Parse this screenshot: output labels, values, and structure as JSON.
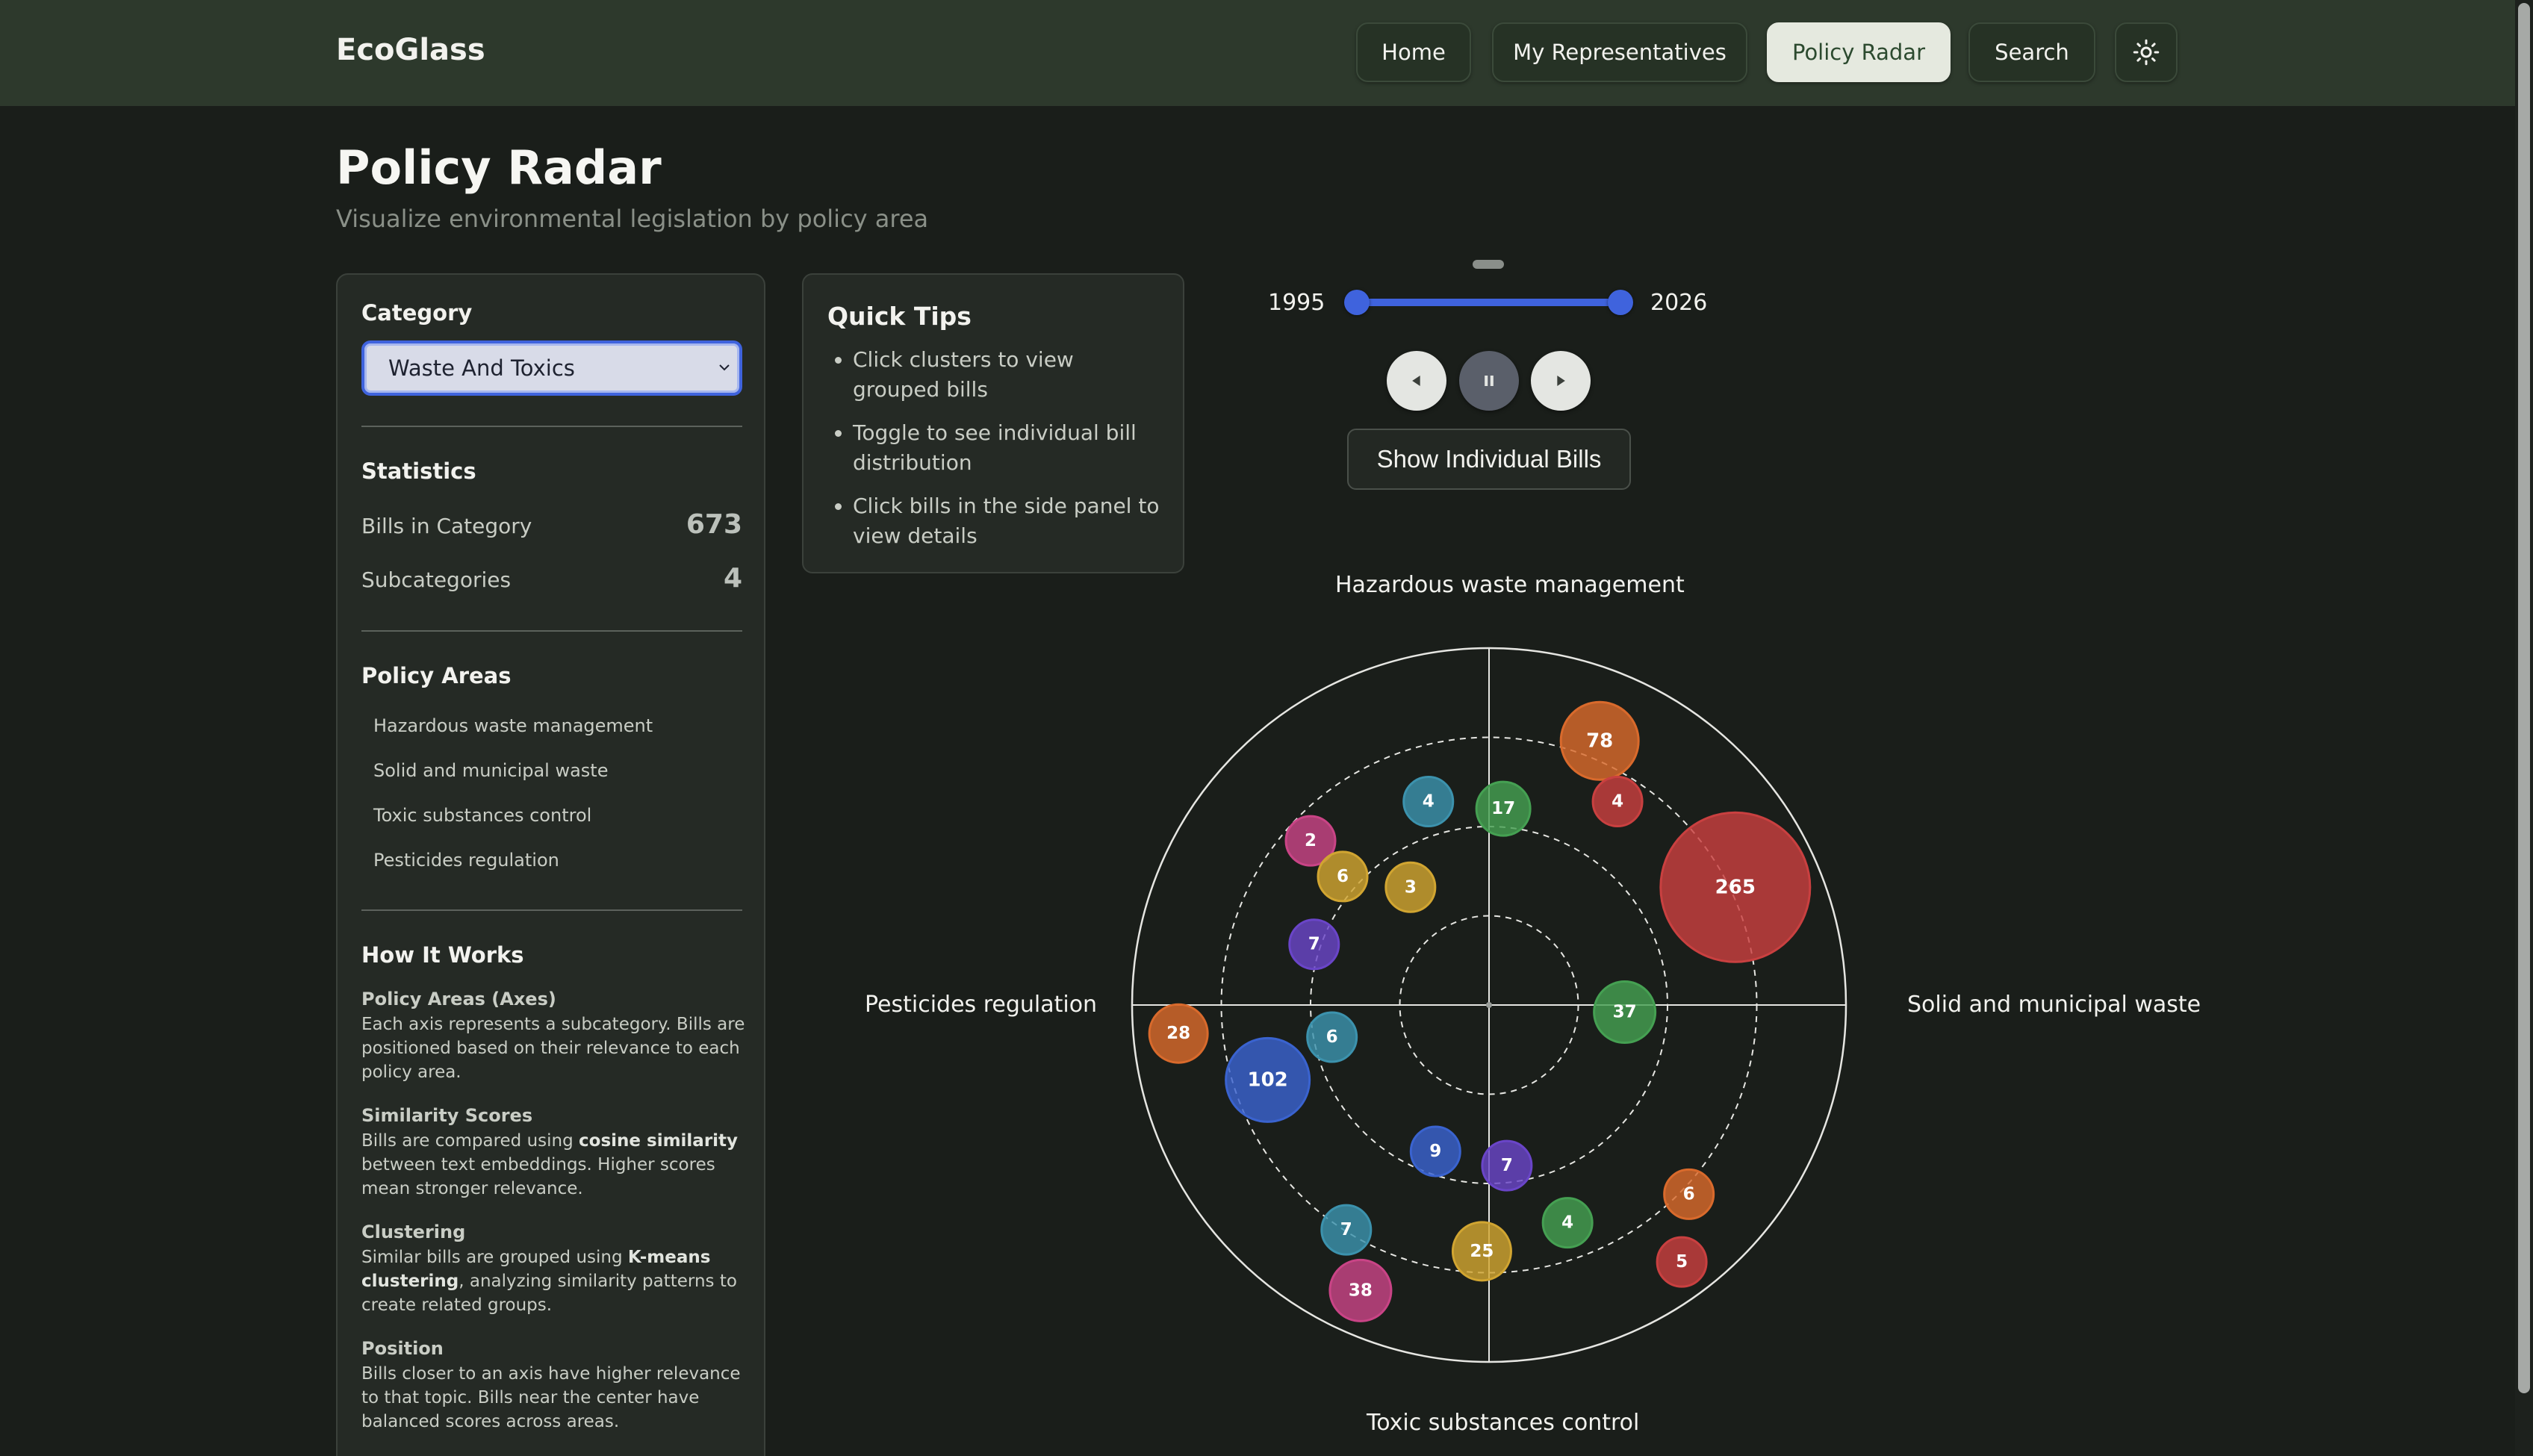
{
  "nav": {
    "brand": "EcoGlass",
    "items": [
      {
        "label": "Home",
        "active": false
      },
      {
        "label": "My Representatives",
        "active": false
      },
      {
        "label": "Policy Radar",
        "active": true
      },
      {
        "label": "Search",
        "active": false
      }
    ],
    "theme_icon": "sun-icon"
  },
  "header": {
    "title": "Policy Radar",
    "subtitle": "Visualize environmental legislation by policy area"
  },
  "sidebar": {
    "category_label": "Category",
    "category_value": "Waste And Toxics",
    "statistics_title": "Statistics",
    "stats": [
      {
        "label": "Bills in Category",
        "value": "673"
      },
      {
        "label": "Subcategories",
        "value": "4"
      }
    ],
    "policy_areas_title": "Policy Areas",
    "policy_areas": [
      "Hazardous waste management",
      "Solid and municipal waste",
      "Toxic substances control",
      "Pesticides regulation"
    ],
    "how_title": "How It Works",
    "how": [
      {
        "title": "Policy Areas (Axes)",
        "parts": [
          "Each axis represents a subcategory. Bills are positioned based on their relevance to each policy area."
        ]
      },
      {
        "title": "Similarity Scores",
        "parts": [
          "Bills are compared using ",
          "cosine similarity",
          " between text embeddings. Higher scores mean stronger relevance."
        ]
      },
      {
        "title": "Clustering",
        "parts": [
          "Similar bills are grouped using ",
          "K-means clustering",
          ", analyzing similarity patterns to create related groups."
        ]
      },
      {
        "title": "Position",
        "parts": [
          "Bills closer to an axis have higher relevance to that topic. Bills near the center have balanced scores across areas."
        ]
      }
    ]
  },
  "tips": {
    "title": "Quick Tips",
    "items": [
      "Click clusters to view grouped bills",
      "Toggle to see individual bill distribution",
      "Click bills in the side panel to view details"
    ]
  },
  "timeline": {
    "start_year": "1995",
    "end_year": "2026",
    "range": [
      1995,
      2026
    ],
    "selected": [
      1995,
      2026
    ],
    "show_button": "Show Individual Bills",
    "prev_icon": "prev-icon",
    "pause_icon": "pause-icon",
    "next_icon": "next-icon"
  },
  "colors": {
    "accent": "#3f63dd",
    "orange": "#d96a2c",
    "red": "#c94040",
    "green": "#45a052",
    "teal": "#3c92ad",
    "pink": "#c94486",
    "yellow": "#d1a531",
    "purple": "#6a45c8",
    "blue": "#3a63cf"
  },
  "chart_data": {
    "type": "scatter",
    "axes": {
      "top": "Hazardous waste management",
      "right": "Solid and municipal waste",
      "bottom": "Toxic substances control",
      "left": "Pesticides regulation"
    },
    "rings": 4,
    "x_range": [
      -1,
      1
    ],
    "y_range": [
      -1,
      1
    ],
    "clusters": [
      {
        "count": 78,
        "x": 0.31,
        "y": 0.74,
        "color": "orange"
      },
      {
        "count": 4,
        "x": 0.36,
        "y": 0.57,
        "color": "red"
      },
      {
        "count": 265,
        "x": 0.69,
        "y": 0.33,
        "color": "red"
      },
      {
        "count": 17,
        "x": 0.04,
        "y": 0.55,
        "color": "green"
      },
      {
        "count": 4,
        "x": -0.17,
        "y": 0.57,
        "color": "teal"
      },
      {
        "count": 2,
        "x": -0.5,
        "y": 0.46,
        "color": "pink"
      },
      {
        "count": 6,
        "x": -0.41,
        "y": 0.36,
        "color": "yellow"
      },
      {
        "count": 3,
        "x": -0.22,
        "y": 0.33,
        "color": "yellow"
      },
      {
        "count": 7,
        "x": -0.49,
        "y": 0.17,
        "color": "purple"
      },
      {
        "count": 37,
        "x": 0.38,
        "y": -0.02,
        "color": "green"
      },
      {
        "count": 28,
        "x": -0.87,
        "y": -0.08,
        "color": "orange"
      },
      {
        "count": 6,
        "x": -0.44,
        "y": -0.09,
        "color": "teal"
      },
      {
        "count": 102,
        "x": -0.62,
        "y": -0.21,
        "color": "blue"
      },
      {
        "count": 9,
        "x": -0.15,
        "y": -0.41,
        "color": "blue"
      },
      {
        "count": 7,
        "x": 0.05,
        "y": -0.45,
        "color": "purple"
      },
      {
        "count": 4,
        "x": 0.22,
        "y": -0.61,
        "color": "green"
      },
      {
        "count": 6,
        "x": 0.56,
        "y": -0.53,
        "color": "orange"
      },
      {
        "count": 7,
        "x": -0.4,
        "y": -0.63,
        "color": "teal"
      },
      {
        "count": 25,
        "x": -0.02,
        "y": -0.69,
        "color": "yellow"
      },
      {
        "count": 38,
        "x": -0.36,
        "y": -0.8,
        "color": "pink"
      },
      {
        "count": 5,
        "x": 0.54,
        "y": -0.72,
        "color": "red"
      }
    ]
  }
}
